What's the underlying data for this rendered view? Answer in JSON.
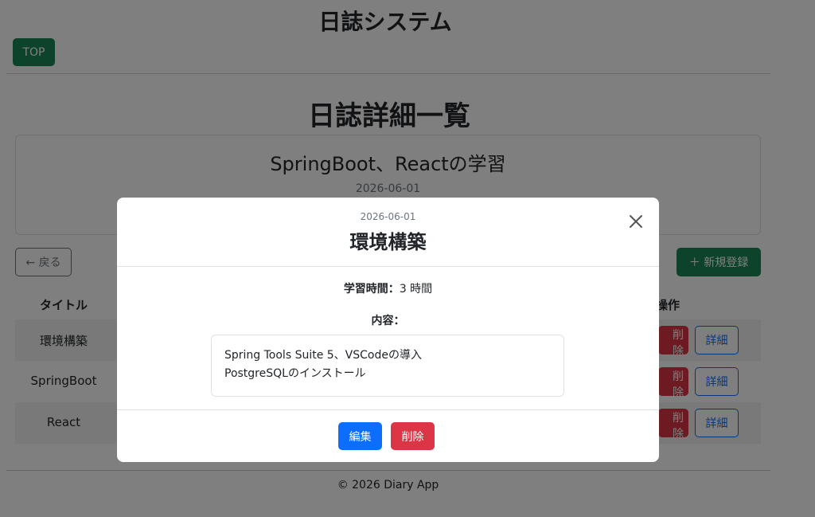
{
  "header": {
    "app_title": "日誌システム",
    "top_button": "TOP"
  },
  "main": {
    "heading": "日誌詳細一覧",
    "summary": {
      "title": "SpringBoot、Reactの学習",
      "date": "2026-06-01"
    },
    "back_button": "← 戻る",
    "new_button": "＋ 新規登録",
    "table": {
      "headers": {
        "title": "タイトル",
        "action": "操作"
      },
      "rows": [
        {
          "title": "環境構築",
          "delete": "削除",
          "detail": "詳細"
        },
        {
          "title": "SpringBoot",
          "delete": "削除",
          "detail": "詳細"
        },
        {
          "title": "React",
          "delete": "削除",
          "detail": "詳細"
        }
      ]
    }
  },
  "footer": {
    "text": "© 2026 Diary App"
  },
  "modal": {
    "date": "2026-06-01",
    "title": "環境構築",
    "study_time_label": "学習時間：",
    "study_time_value": "3 時間",
    "content_label": "内容：",
    "content_lines": [
      "Spring Tools Suite 5、VSCodeの導入",
      "PostgreSQLのインストール"
    ],
    "edit_button": "編集",
    "delete_button": "削除",
    "close_icon": "close-icon"
  },
  "colors": {
    "primary": "#0d6efd",
    "success": "#198754",
    "danger": "#dc3545",
    "secondary": "#6c757d"
  }
}
